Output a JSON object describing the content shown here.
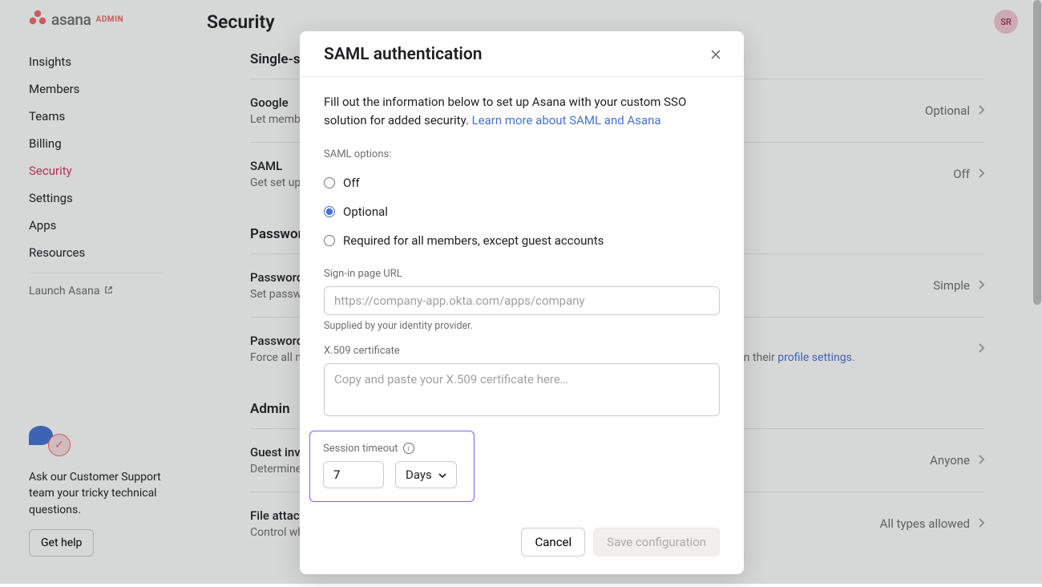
{
  "brand": {
    "name": "asana",
    "badge": "ADMIN"
  },
  "avatar": {
    "initials": "SR"
  },
  "sidebar": {
    "items": [
      {
        "label": "Insights"
      },
      {
        "label": "Members"
      },
      {
        "label": "Teams"
      },
      {
        "label": "Billing"
      },
      {
        "label": "Security",
        "active": true
      },
      {
        "label": "Settings"
      },
      {
        "label": "Apps"
      },
      {
        "label": "Resources"
      }
    ],
    "launch_label": "Launch Asana",
    "help_text": "Ask our Customer Support team your tricky technical questions.",
    "help_button": "Get help"
  },
  "page": {
    "title": "Security"
  },
  "sections": {
    "sso": {
      "title": "Single-sign on (SSO)",
      "rows": [
        {
          "title": "Google",
          "desc": "Let members sign in with their Google account",
          "value": "Optional"
        },
        {
          "title": "SAML",
          "desc": "Get set up with a separate SSO provider for added security",
          "value": "Off"
        }
      ]
    },
    "password": {
      "title": "Password",
      "rows": [
        {
          "title": "Password strength",
          "desc": "Set password requirements for all members of your organization",
          "value": "Simple"
        },
        {
          "title": "Password reset",
          "desc": "Force all members to change their password. Members can always reset their own passwords within their ",
          "link": "profile settings",
          "tail": ".",
          "value": ""
        }
      ]
    },
    "admin": {
      "title": "Admin",
      "rows": [
        {
          "title": "Guest invite permissions",
          "desc": "Determine who can invite guests to your organization",
          "value": "Anyone"
        },
        {
          "title": "File attachment options",
          "desc": "Control which file attachment types should be used in your Organization",
          "value": "All types allowed"
        }
      ]
    }
  },
  "modal": {
    "title": "SAML authentication",
    "intro_a": "Fill out the information below to set up Asana with your custom SSO solution for added security. ",
    "intro_link": "Learn more about SAML and Asana",
    "options_label": "SAML options:",
    "options": [
      {
        "label": "Off"
      },
      {
        "label": "Optional",
        "checked": true
      },
      {
        "label": "Required for all members, except guest accounts"
      }
    ],
    "url_label": "Sign-in page URL",
    "url_placeholder": "https://company-app.okta.com/apps/company",
    "url_help": "Supplied by your identity provider.",
    "cert_label": "X.509 certificate",
    "cert_placeholder": "Copy and paste your X.509 certificate here…",
    "session_label": "Session timeout",
    "session_value": "7",
    "session_unit": "Days",
    "cancel": "Cancel",
    "save": "Save configuration"
  }
}
